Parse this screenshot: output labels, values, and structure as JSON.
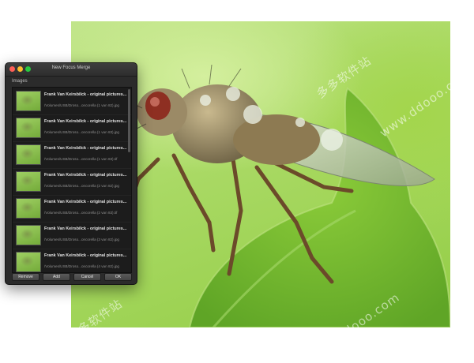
{
  "window": {
    "title": "New Focus Merge"
  },
  "images_label": "Images",
  "images": [
    {
      "title": "Frank Van Keirsbilck - original pictures...",
      "path": "/Volumes/USB/Droso...oncorella (1 van 82).jpg"
    },
    {
      "title": "Frank Van Keirsbilck - original pictures...",
      "path": "/Volumes/USB/Droso...oncorella (1 van 83).jpg"
    },
    {
      "title": "Frank Van Keirsbilck - original pictures...",
      "path": "/Volumes/USB/Droso...oncorella (1 van 83).tif"
    },
    {
      "title": "Frank Van Keirsbilck - original pictures...",
      "path": "/Volumes/USB/Droso...oncorella (2 van 82).jpg"
    },
    {
      "title": "Frank Van Keirsbilck - original pictures...",
      "path": "/Volumes/USB/Droso...oncorella (2 van 83).tif"
    },
    {
      "title": "Frank Van Keirsbilck - original pictures...",
      "path": "/Volumes/USB/Droso...oncorella (3 van 82).jpg"
    },
    {
      "title": "Frank Van Keirsbilck - original pictures...",
      "path": "/Volumes/USB/Droso...oncorella (4 van 82).jpg"
    }
  ],
  "buttons": {
    "remove": "Remove",
    "add": "Add",
    "cancel": "Cancel",
    "ok": "OK"
  },
  "watermarks": [
    "多多软件站",
    "www.ddooo.com",
    "多多软件站",
    "www.ddooo.com"
  ]
}
